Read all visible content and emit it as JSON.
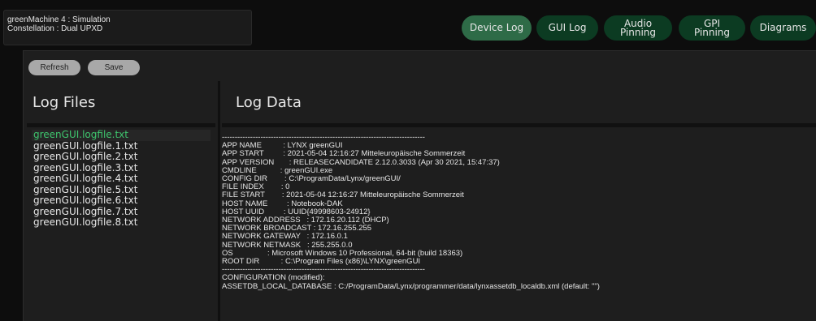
{
  "device_info": {
    "line1": "greenMachine 4 : Simulation",
    "line2": "Constellation : Dual UPXD"
  },
  "tabs": [
    {
      "label": "Device Log",
      "active": true
    },
    {
      "label": "GUI Log",
      "active": false
    },
    {
      "label_lines": [
        "Audio",
        "Pinning"
      ],
      "active": false
    },
    {
      "label_lines": [
        "GPI",
        "Pinning"
      ],
      "active": false
    },
    {
      "label": "Diagrams",
      "active": false
    }
  ],
  "toolbar": {
    "refresh_label": "Refresh",
    "save_label": "Save"
  },
  "log_files_panel": {
    "title": "Log Files",
    "selected_index": 0,
    "files": [
      "greenGUI.logfile.txt",
      "greenGUI.logfile.1.txt",
      "greenGUI.logfile.2.txt",
      "greenGUI.logfile.3.txt",
      "greenGUI.logfile.4.txt",
      "greenGUI.logfile.5.txt",
      "greenGUI.logfile.6.txt",
      "greenGUI.logfile.7.txt",
      "greenGUI.logfile.8.txt"
    ]
  },
  "log_data_panel": {
    "title": "Log Data",
    "lines": [
      "-------------------------------------------------------------------------------",
      "APP NAME          : LYNX greenGUI",
      "APP START         : 2021-05-04 12:16:27 Mitteleuropäische Sommerzeit",
      "APP VERSION       : RELEASECANDIDATE 2.12.0.3033 (Apr 30 2021, 15:47:37)",
      "CMDLINE           : greenGUI.exe",
      "CONFIG DIR        : C:\\ProgramData/Lynx/greenGUI/",
      "FILE INDEX        : 0",
      "FILE START        : 2021-05-04 12:16:27 Mitteleuropäische Sommerzeit",
      "HOST NAME         : Notebook-DAK",
      "HOST UUID         : UUID{49998603-24912}",
      "NETWORK ADDRESS   : 172.16.20.112 (DHCP)",
      "NETWORK BROADCAST : 172.16.255.255",
      "NETWORK GATEWAY   : 172.16.0.1",
      "NETWORK NETMASK   : 255.255.0.0",
      "OS                : Microsoft Windows 10 Professional, 64-bit (build 18363)",
      "ROOT DIR          : C:\\Program Files (x86)\\LYNX\\greenGUI",
      "-------------------------------------------------------------------------------",
      "CONFIGURATION (modified):",
      "ASSETDB_LOCAL_DATABASE : C:/ProgramData/Lynx/programmer/data/lynxassetdb_localdb.xml (default: \"\")"
    ]
  },
  "colors": {
    "active_tab": "#2e6b47",
    "inactive_tab": "#0c3b22",
    "selected_file": "#3ec46d",
    "panel_bg": "#1e1e1e",
    "button_bg": "#a8a8a8"
  }
}
